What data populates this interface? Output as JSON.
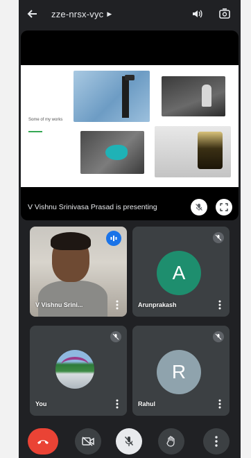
{
  "header": {
    "meeting_code": "zze-nrsx-vyc",
    "back_icon": "back-arrow-icon",
    "speaker_icon": "speaker-icon",
    "switch_camera_icon": "switch-camera-icon"
  },
  "presentation": {
    "slide_title": "Some of my works",
    "presenting_text": "V Vishnu Srinivasa Prasad is presenting",
    "mute_icon": "mic-off-icon",
    "fullscreen_icon": "fullscreen-icon"
  },
  "participants": [
    {
      "name": "V Vishnu Srini...",
      "type": "video",
      "status": "speaking"
    },
    {
      "name": "Arunprakash",
      "initial": "A",
      "avatar_color": "#1e8e6e",
      "status": "muted"
    },
    {
      "name": "You",
      "type": "photo",
      "status": "muted"
    },
    {
      "name": "Rahul",
      "initial": "R",
      "avatar_color": "#8fa3ad",
      "status": "muted"
    }
  ],
  "controls": {
    "hangup_icon": "hang-up-icon",
    "camera_icon": "camera-off-icon",
    "mic_icon": "mic-off-icon",
    "hand_icon": "raise-hand-icon",
    "more_icon": "more-vert-icon"
  },
  "colors": {
    "background": "#202124",
    "tile": "#3c4043",
    "hangup": "#ea4335",
    "speaking_badge": "#1a73e8"
  }
}
